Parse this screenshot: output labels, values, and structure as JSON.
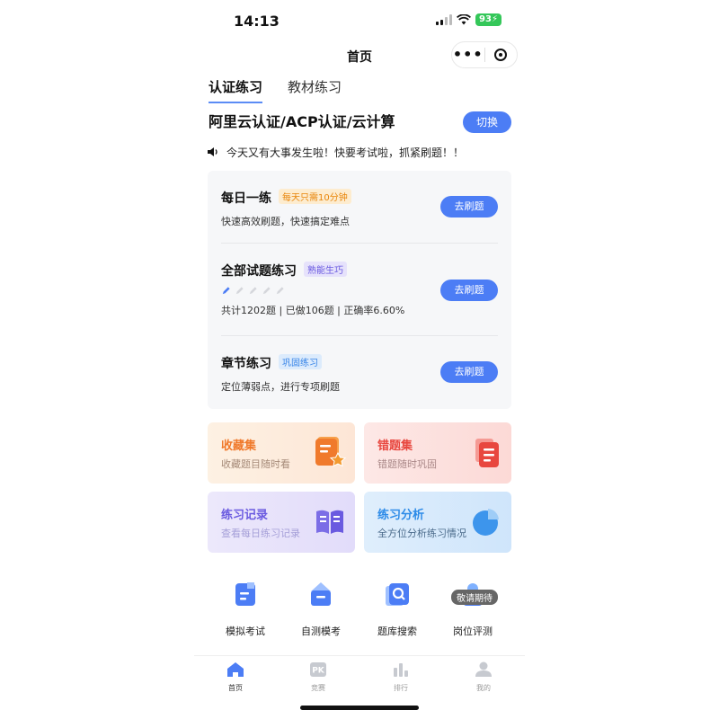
{
  "status_bar": {
    "time": "14:13",
    "battery": "93"
  },
  "navbar": {
    "title": "首页"
  },
  "tabs": [
    {
      "label": "认证练习",
      "active": true
    },
    {
      "label": "教材练习",
      "active": false
    }
  ],
  "cert": {
    "name": "阿里云认证/ACP认证/云计算",
    "switch_label": "切换"
  },
  "notice": {
    "text": "今天又有大事发生啦！快要考试啦，抓紧刷题！！"
  },
  "practice": [
    {
      "title": "每日一练",
      "tag": "每天只需10分钟",
      "desc": "快速高效刷题，快速搞定难点",
      "button": "去刷题"
    },
    {
      "title": "全部试题练习",
      "tag": "熟能生巧",
      "desc": "共计1202题 | 已做106题 | 正确率6.60%",
      "button": "去刷题",
      "level": 1,
      "level_max": 5
    },
    {
      "title": "章节练习",
      "tag": "巩固练习",
      "desc": "定位薄弱点，进行专项刷题",
      "button": "去刷题"
    }
  ],
  "tiles": [
    {
      "title": "收藏集",
      "desc": "收藏题目随时看",
      "color": "#f07a2c"
    },
    {
      "title": "错题集",
      "desc": "错题随时巩固",
      "color": "#e8473f"
    },
    {
      "title": "练习记录",
      "desc": "查看每日练习记录",
      "color": "#6a5ae0"
    },
    {
      "title": "练习分析",
      "desc": "全方位分析练习情况",
      "color": "#2d8be8"
    }
  ],
  "tools": [
    {
      "label": "模拟考试",
      "icon": "exam-doc-icon"
    },
    {
      "label": "自测模考",
      "icon": "self-test-icon"
    },
    {
      "label": "题库搜索",
      "icon": "search-bank-icon"
    },
    {
      "label": "岗位评测",
      "icon": "job-eval-icon",
      "badge": "敬请期待"
    }
  ],
  "tabbar": [
    {
      "label": "首页",
      "active": true
    },
    {
      "label": "竞赛",
      "active": false
    },
    {
      "label": "排行",
      "active": false
    },
    {
      "label": "我的",
      "active": false
    }
  ],
  "colors": {
    "accent": "#4c7df5",
    "tab_underline": "#5b8cf5"
  }
}
